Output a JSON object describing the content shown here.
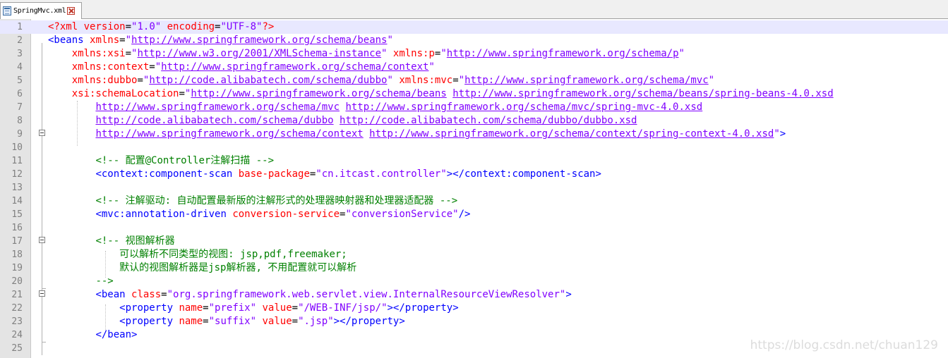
{
  "tab": {
    "filename": "SpringMvc.xml",
    "icon": "file-xml-icon",
    "close_icon": "close-tab-icon"
  },
  "watermark": "https://blog.csdn.net/chuan129",
  "lines": [
    {
      "n": "1",
      "indent": "",
      "tokens": [
        {
          "c": "a",
          "t": "<?xml "
        },
        {
          "c": "a",
          "t": "version"
        },
        {
          "c": "q",
          "t": "="
        },
        {
          "c": "v",
          "t": "\"1.0\""
        },
        {
          "c": "a",
          "t": " encoding"
        },
        {
          "c": "q",
          "t": "="
        },
        {
          "c": "v",
          "t": "\"UTF-8\""
        },
        {
          "c": "a",
          "t": "?>"
        }
      ]
    },
    {
      "n": "2",
      "indent": "",
      "tokens": [
        {
          "c": "t",
          "t": "<beans "
        },
        {
          "c": "a",
          "t": "xmlns"
        },
        {
          "c": "q",
          "t": "="
        },
        {
          "c": "v",
          "t": "\""
        },
        {
          "c": "u",
          "t": "http://www.springframework.org/schema/beans"
        },
        {
          "c": "v",
          "t": "\""
        }
      ]
    },
    {
      "n": "3",
      "indent": "    ",
      "tokens": [
        {
          "c": "a",
          "t": "xmlns:xsi"
        },
        {
          "c": "q",
          "t": "="
        },
        {
          "c": "v",
          "t": "\""
        },
        {
          "c": "u",
          "t": "http://www.w3.org/2001/XMLSchema-instance"
        },
        {
          "c": "v",
          "t": "\""
        },
        {
          "c": "a",
          "t": " xmlns:p"
        },
        {
          "c": "q",
          "t": "="
        },
        {
          "c": "v",
          "t": "\""
        },
        {
          "c": "u",
          "t": "http://www.springframework.org/schema/p"
        },
        {
          "c": "v",
          "t": "\""
        }
      ]
    },
    {
      "n": "4",
      "indent": "    ",
      "tokens": [
        {
          "c": "a",
          "t": "xmlns:context"
        },
        {
          "c": "q",
          "t": "="
        },
        {
          "c": "v",
          "t": "\""
        },
        {
          "c": "u",
          "t": "http://www.springframework.org/schema/context"
        },
        {
          "c": "v",
          "t": "\""
        }
      ]
    },
    {
      "n": "5",
      "indent": "    ",
      "tokens": [
        {
          "c": "a",
          "t": "xmlns:dubbo"
        },
        {
          "c": "q",
          "t": "="
        },
        {
          "c": "v",
          "t": "\""
        },
        {
          "c": "u",
          "t": "http://code.alibabatech.com/schema/dubbo"
        },
        {
          "c": "v",
          "t": "\""
        },
        {
          "c": "a",
          "t": " xmlns:mvc"
        },
        {
          "c": "q",
          "t": "="
        },
        {
          "c": "v",
          "t": "\""
        },
        {
          "c": "u",
          "t": "http://www.springframework.org/schema/mvc"
        },
        {
          "c": "v",
          "t": "\""
        }
      ]
    },
    {
      "n": "6",
      "indent": "    ",
      "tokens": [
        {
          "c": "a",
          "t": "xsi:schemaLocation"
        },
        {
          "c": "q",
          "t": "="
        },
        {
          "c": "v",
          "t": "\""
        },
        {
          "c": "u",
          "t": "http://www.springframework.org/schema/beans"
        },
        {
          "c": "v",
          "t": " "
        },
        {
          "c": "u",
          "t": "http://www.springframework.org/schema/beans/spring-beans-4.0.xsd"
        }
      ]
    },
    {
      "n": "7",
      "indent": "        ",
      "tokens": [
        {
          "c": "u",
          "t": "http://www.springframework.org/schema/mvc"
        },
        {
          "c": "v",
          "t": " "
        },
        {
          "c": "u",
          "t": "http://www.springframework.org/schema/mvc/spring-mvc-4.0.xsd"
        }
      ]
    },
    {
      "n": "8",
      "indent": "        ",
      "tokens": [
        {
          "c": "u",
          "t": "http://code.alibabatech.com/schema/dubbo"
        },
        {
          "c": "v",
          "t": " "
        },
        {
          "c": "u",
          "t": "http://code.alibabatech.com/schema/dubbo/dubbo.xsd"
        }
      ]
    },
    {
      "n": "9",
      "indent": "        ",
      "tokens": [
        {
          "c": "u",
          "t": "http://www.springframework.org/schema/context"
        },
        {
          "c": "v",
          "t": " "
        },
        {
          "c": "u",
          "t": "http://www.springframework.org/schema/context/spring-context-4.0.xsd"
        },
        {
          "c": "v",
          "t": "\""
        },
        {
          "c": "t",
          "t": ">"
        }
      ]
    },
    {
      "n": "10",
      "indent": "",
      "tokens": []
    },
    {
      "n": "11",
      "indent": "        ",
      "tokens": [
        {
          "c": "c",
          "t": "<!-- 配置@Controller注解扫描 -->"
        }
      ]
    },
    {
      "n": "12",
      "indent": "        ",
      "tokens": [
        {
          "c": "t",
          "t": "<context:component-scan "
        },
        {
          "c": "a",
          "t": "base-package"
        },
        {
          "c": "q",
          "t": "="
        },
        {
          "c": "v",
          "t": "\"cn.itcast.controller\""
        },
        {
          "c": "t",
          "t": "></context:component-scan>"
        }
      ]
    },
    {
      "n": "13",
      "indent": "",
      "tokens": []
    },
    {
      "n": "14",
      "indent": "        ",
      "tokens": [
        {
          "c": "c",
          "t": "<!-- 注解驱动: 自动配置最新版的注解形式的处理器映射器和处理器适配器 -->"
        }
      ]
    },
    {
      "n": "15",
      "indent": "        ",
      "tokens": [
        {
          "c": "t",
          "t": "<mvc:annotation-driven "
        },
        {
          "c": "a",
          "t": "conversion-service"
        },
        {
          "c": "q",
          "t": "="
        },
        {
          "c": "v",
          "t": "\"conversionService\""
        },
        {
          "c": "t",
          "t": "/>"
        }
      ]
    },
    {
      "n": "16",
      "indent": "",
      "tokens": []
    },
    {
      "n": "17",
      "indent": "        ",
      "tokens": [
        {
          "c": "c",
          "t": "<!-- 视图解析器"
        }
      ]
    },
    {
      "n": "18",
      "indent": "            ",
      "tokens": [
        {
          "c": "c",
          "t": "可以解析不同类型的视图: jsp,pdf,freemaker;"
        }
      ]
    },
    {
      "n": "19",
      "indent": "            ",
      "tokens": [
        {
          "c": "c",
          "t": "默认的视图解析器是jsp解析器, 不用配置就可以解析"
        }
      ]
    },
    {
      "n": "20",
      "indent": "        ",
      "tokens": [
        {
          "c": "c",
          "t": "-->"
        }
      ]
    },
    {
      "n": "21",
      "indent": "        ",
      "tokens": [
        {
          "c": "t",
          "t": "<bean "
        },
        {
          "c": "a",
          "t": "class"
        },
        {
          "c": "q",
          "t": "="
        },
        {
          "c": "v",
          "t": "\"org.springframework.web.servlet.view.InternalResourceViewResolver\""
        },
        {
          "c": "t",
          "t": ">"
        }
      ]
    },
    {
      "n": "22",
      "indent": "            ",
      "tokens": [
        {
          "c": "t",
          "t": "<property "
        },
        {
          "c": "a",
          "t": "name"
        },
        {
          "c": "q",
          "t": "="
        },
        {
          "c": "v",
          "t": "\"prefix\""
        },
        {
          "c": "a",
          "t": " value"
        },
        {
          "c": "q",
          "t": "="
        },
        {
          "c": "v",
          "t": "\"/WEB-INF/jsp/\""
        },
        {
          "c": "t",
          "t": "></property>"
        }
      ]
    },
    {
      "n": "23",
      "indent": "            ",
      "tokens": [
        {
          "c": "t",
          "t": "<property "
        },
        {
          "c": "a",
          "t": "name"
        },
        {
          "c": "q",
          "t": "="
        },
        {
          "c": "v",
          "t": "\"suffix\""
        },
        {
          "c": "a",
          "t": " value"
        },
        {
          "c": "q",
          "t": "="
        },
        {
          "c": "v",
          "t": "\".jsp\""
        },
        {
          "c": "t",
          "t": "></property>"
        }
      ]
    },
    {
      "n": "24",
      "indent": "        ",
      "tokens": [
        {
          "c": "t",
          "t": "</bean>"
        }
      ]
    },
    {
      "n": "25",
      "indent": "",
      "tokens": []
    }
  ]
}
